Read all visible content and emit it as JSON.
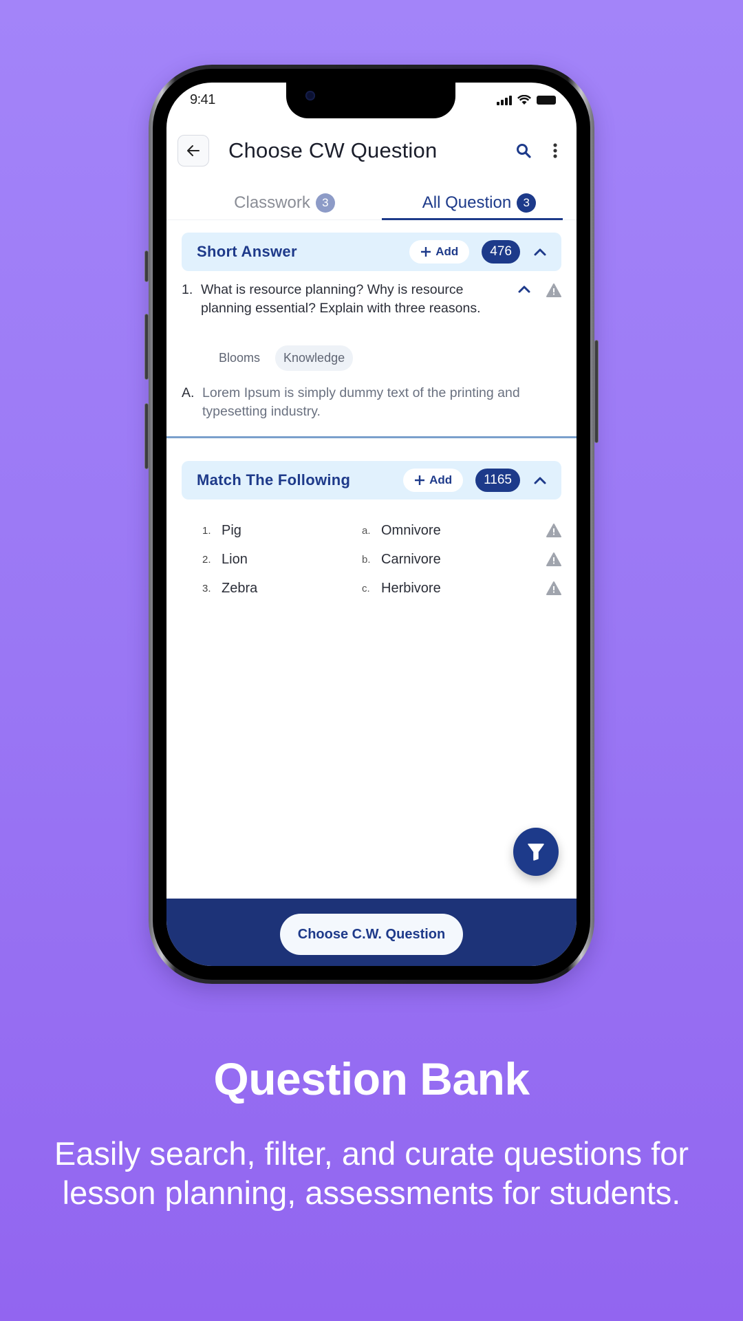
{
  "status_bar": {
    "time": "9:41"
  },
  "header": {
    "title": "Choose CW Question",
    "icons": {
      "back": "arrow-left-icon",
      "search": "search-icon",
      "more": "more-vertical-icon"
    }
  },
  "tabs": [
    {
      "label": "Classwork",
      "count": "3",
      "active": false
    },
    {
      "label": "All Question",
      "count": "3",
      "active": true
    }
  ],
  "sections": {
    "short_answer": {
      "title": "Short Answer",
      "add_label": "Add",
      "count": "476",
      "question": {
        "number": "1.",
        "text": "What is resource planning? Why is resource planning essential? Explain with three reasons.",
        "tags": [
          "Blooms",
          "Knowledge"
        ],
        "answer_label": "A.",
        "answer_text": "Lorem Ipsum is simply dummy text of the printing and typesetting industry."
      }
    },
    "match_following": {
      "title": "Match The Following",
      "add_label": "Add",
      "count": "1165",
      "rows": [
        {
          "num": "1.",
          "left": "Pig",
          "letter": "a.",
          "right": "Omnivore"
        },
        {
          "num": "2.",
          "left": "Lion",
          "letter": "b.",
          "right": "Carnivore"
        },
        {
          "num": "3.",
          "left": "Zebra",
          "letter": "c.",
          "right": "Herbivore"
        }
      ]
    }
  },
  "fab": {
    "icon": "filter-icon"
  },
  "bottom_bar": {
    "primary_button": "Choose C.W. Question"
  },
  "promo": {
    "title": "Question Bank",
    "subtitle": "Easily search, filter, and curate questions for lesson planning, assessments for students."
  },
  "colors": {
    "primary": "#1d3a8a",
    "section_bg": "#e1f1fd",
    "background": "#9a77f4"
  }
}
